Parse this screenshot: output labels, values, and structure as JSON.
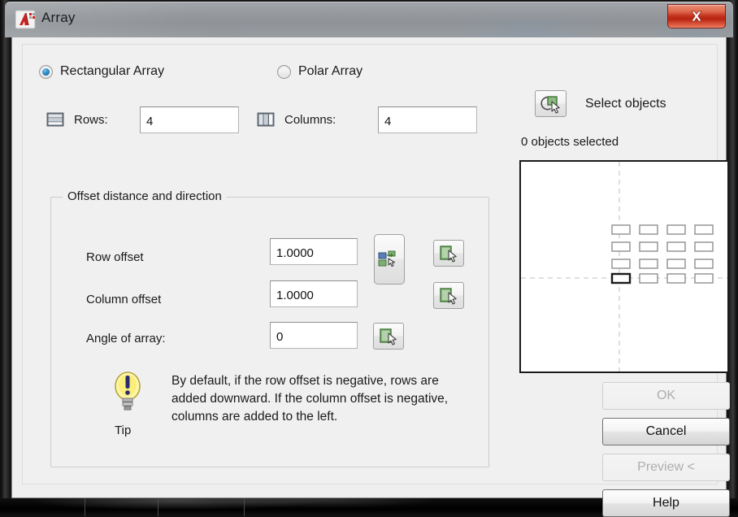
{
  "window": {
    "title": "Array",
    "app_icon": "autocad-logo-icon",
    "close_label": "x"
  },
  "array_type": {
    "rectangular": {
      "label": "Rectangular Array",
      "selected": true
    },
    "polar": {
      "label": "Polar Array",
      "selected": false
    }
  },
  "grid": {
    "rows_label": "Rows:",
    "rows_value": "4",
    "rows_icon": "rows-icon",
    "columns_label": "Columns:",
    "columns_value": "4",
    "columns_icon": "columns-icon"
  },
  "offset_group": {
    "title": "Offset distance and direction",
    "row_offset": {
      "label": "Row offset",
      "value": "1.0000"
    },
    "column_offset": {
      "label": "Column offset",
      "value": "1.0000"
    },
    "angle_of_array": {
      "label": "Angle of array:",
      "value": "0"
    },
    "pick_both_offsets_icon": "pick-both-offsets-icon",
    "pick_row_offset_icon": "pick-row-offset-icon",
    "pick_column_offset_icon": "pick-column-offset-icon",
    "pick_angle_icon": "pick-angle-icon"
  },
  "tip": {
    "icon": "lightbulb-icon",
    "word": "Tip",
    "text": "By default, if the row offset is negative, rows are added downward.  If the column offset is negative, columns are added to the left."
  },
  "selection": {
    "select_objects_label": "Select objects",
    "select_objects_icon": "select-objects-icon",
    "status": "0 objects selected"
  },
  "preview": {
    "rows": 4,
    "columns": 4,
    "base_item_index": 0
  },
  "actions": {
    "ok": {
      "label": "OK",
      "enabled": false
    },
    "cancel": {
      "label": "Cancel",
      "enabled": true
    },
    "preview": {
      "label": "Preview <",
      "enabled": false
    },
    "help": {
      "label": "Help",
      "enabled": true
    }
  },
  "colors": {
    "accent_radio": "#2a86c4",
    "close_button": "#c2301c",
    "pick_icon_green": "#6aab5e",
    "dialog_background": "#efefef"
  }
}
